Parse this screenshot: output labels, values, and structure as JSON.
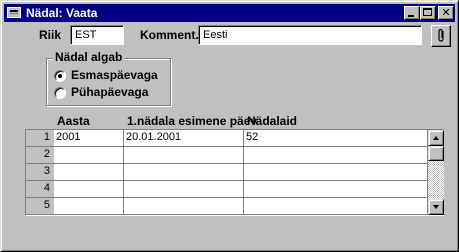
{
  "window": {
    "title": "Nädal: Vaata"
  },
  "form": {
    "country_label": "Riik",
    "country_value": "EST",
    "comment_label": "Komment.",
    "comment_value": "Eesti"
  },
  "week_start": {
    "group_label": "Nädal algab",
    "options": [
      {
        "label": "Esmaspäevaga",
        "selected": true
      },
      {
        "label": "Pühapäevaga",
        "selected": false
      }
    ]
  },
  "grid": {
    "columns": [
      "Aasta",
      "1.nädala esimene päev",
      "Nädalaid"
    ],
    "rows": [
      {
        "num": "1",
        "year": "2001",
        "first_day": "20.01.2001",
        "weeks": "52"
      },
      {
        "num": "2",
        "year": "",
        "first_day": "",
        "weeks": ""
      },
      {
        "num": "3",
        "year": "",
        "first_day": "",
        "weeks": ""
      },
      {
        "num": "4",
        "year": "",
        "first_day": "",
        "weeks": ""
      },
      {
        "num": "5",
        "year": "",
        "first_day": "",
        "weeks": ""
      }
    ]
  },
  "icons": {
    "system_menu": "window-menu-icon",
    "minimize": "minimize-icon",
    "maximize": "maximize-icon",
    "close": "close-icon",
    "attachment": "paperclip-icon",
    "scroll_up": "arrow-up-icon",
    "scroll_down": "arrow-down-icon"
  },
  "colors": {
    "titlebar": "#000080",
    "face": "#c0c0c0",
    "field": "#ffffff"
  }
}
